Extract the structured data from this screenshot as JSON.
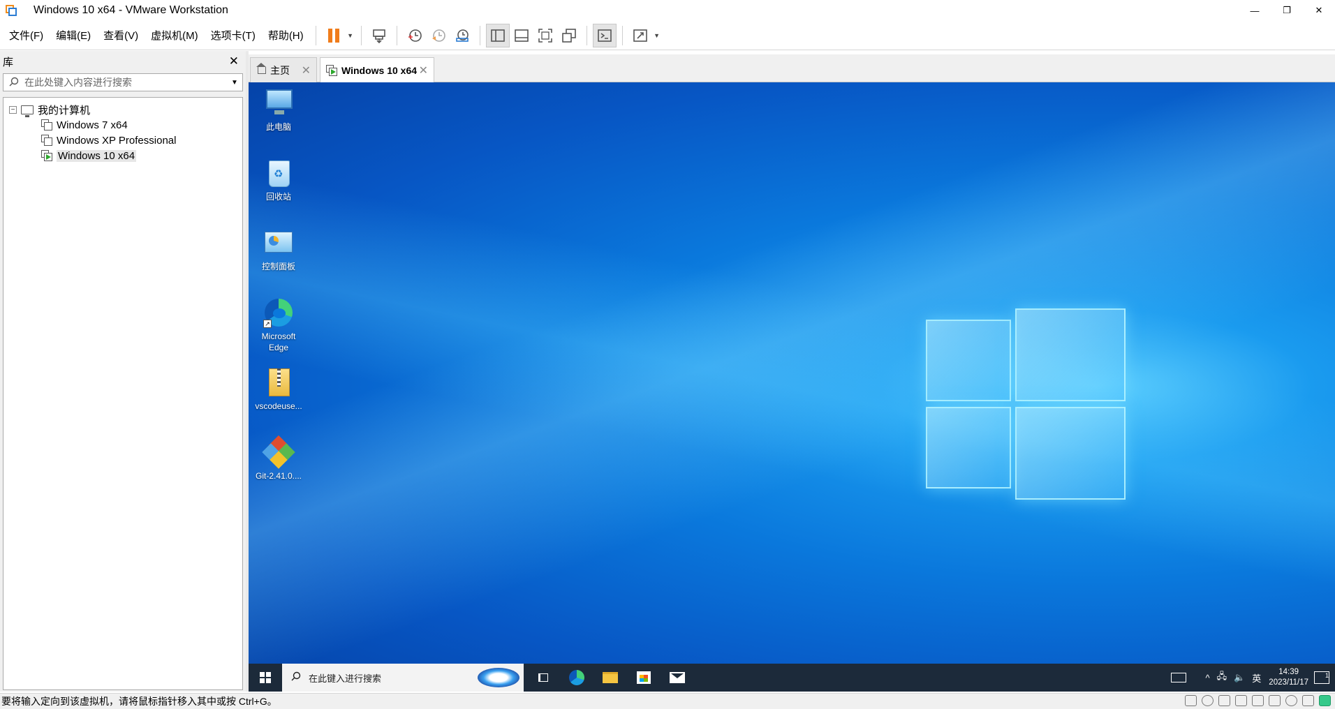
{
  "window": {
    "title": "Windows 10 x64 - VMware Workstation",
    "controls": {
      "minimize": "—",
      "restore": "❐",
      "close": "✕"
    }
  },
  "menu": {
    "items": [
      "文件(F)",
      "编辑(E)",
      "查看(V)",
      "虚拟机(M)",
      "选项卡(T)",
      "帮助(H)"
    ]
  },
  "toolbar": {
    "buttons": [
      "pause-icon",
      "send-ctrl-alt-del-icon",
      "snapshot-icon",
      "revert-snapshot-icon",
      "snapshot-manager-icon",
      "show-library-icon",
      "thumbnail-bar-icon",
      "full-screen-icon",
      "unity-icon",
      "console-view-icon",
      "stretch-guest-icon"
    ],
    "accent": "#f07c1b"
  },
  "library": {
    "title": "库",
    "close": "✕",
    "search_placeholder": "在此处键入内容进行搜索",
    "tree": {
      "root": "我的计算机",
      "expander": "−",
      "vms": [
        "Windows 7 x64",
        "Windows XP Professional",
        "Windows 10 x64"
      ],
      "selected": "Windows 10 x64"
    }
  },
  "tabs": [
    {
      "label": "主页",
      "close": "✕"
    },
    {
      "label": "Windows 10 x64",
      "close": "✕"
    }
  ],
  "guest": {
    "desktop_icons": [
      {
        "label": "此电脑",
        "icon": "this-pc-icon"
      },
      {
        "label": "回收站",
        "icon": "recycle-bin-icon"
      },
      {
        "label": "控制面板",
        "icon": "control-panel-icon"
      },
      {
        "label": "Microsoft Edge",
        "icon": "edge-icon"
      },
      {
        "label": "vscodeuse...",
        "icon": "zip-folder-icon"
      },
      {
        "label": "Git-2.41.0....",
        "icon": "git-installer-icon"
      }
    ],
    "taskbar": {
      "search_placeholder": "在此键入进行搜索",
      "ime": "英",
      "time": "14:39",
      "date": "2023/11/17",
      "notification_count": "1",
      "tray_chevron": "^",
      "volume": "🔈",
      "network": "🖧"
    }
  },
  "status": {
    "message": "要将输入定向到该虚拟机，请将鼠标指针移入其中或按 Ctrl+G。"
  }
}
